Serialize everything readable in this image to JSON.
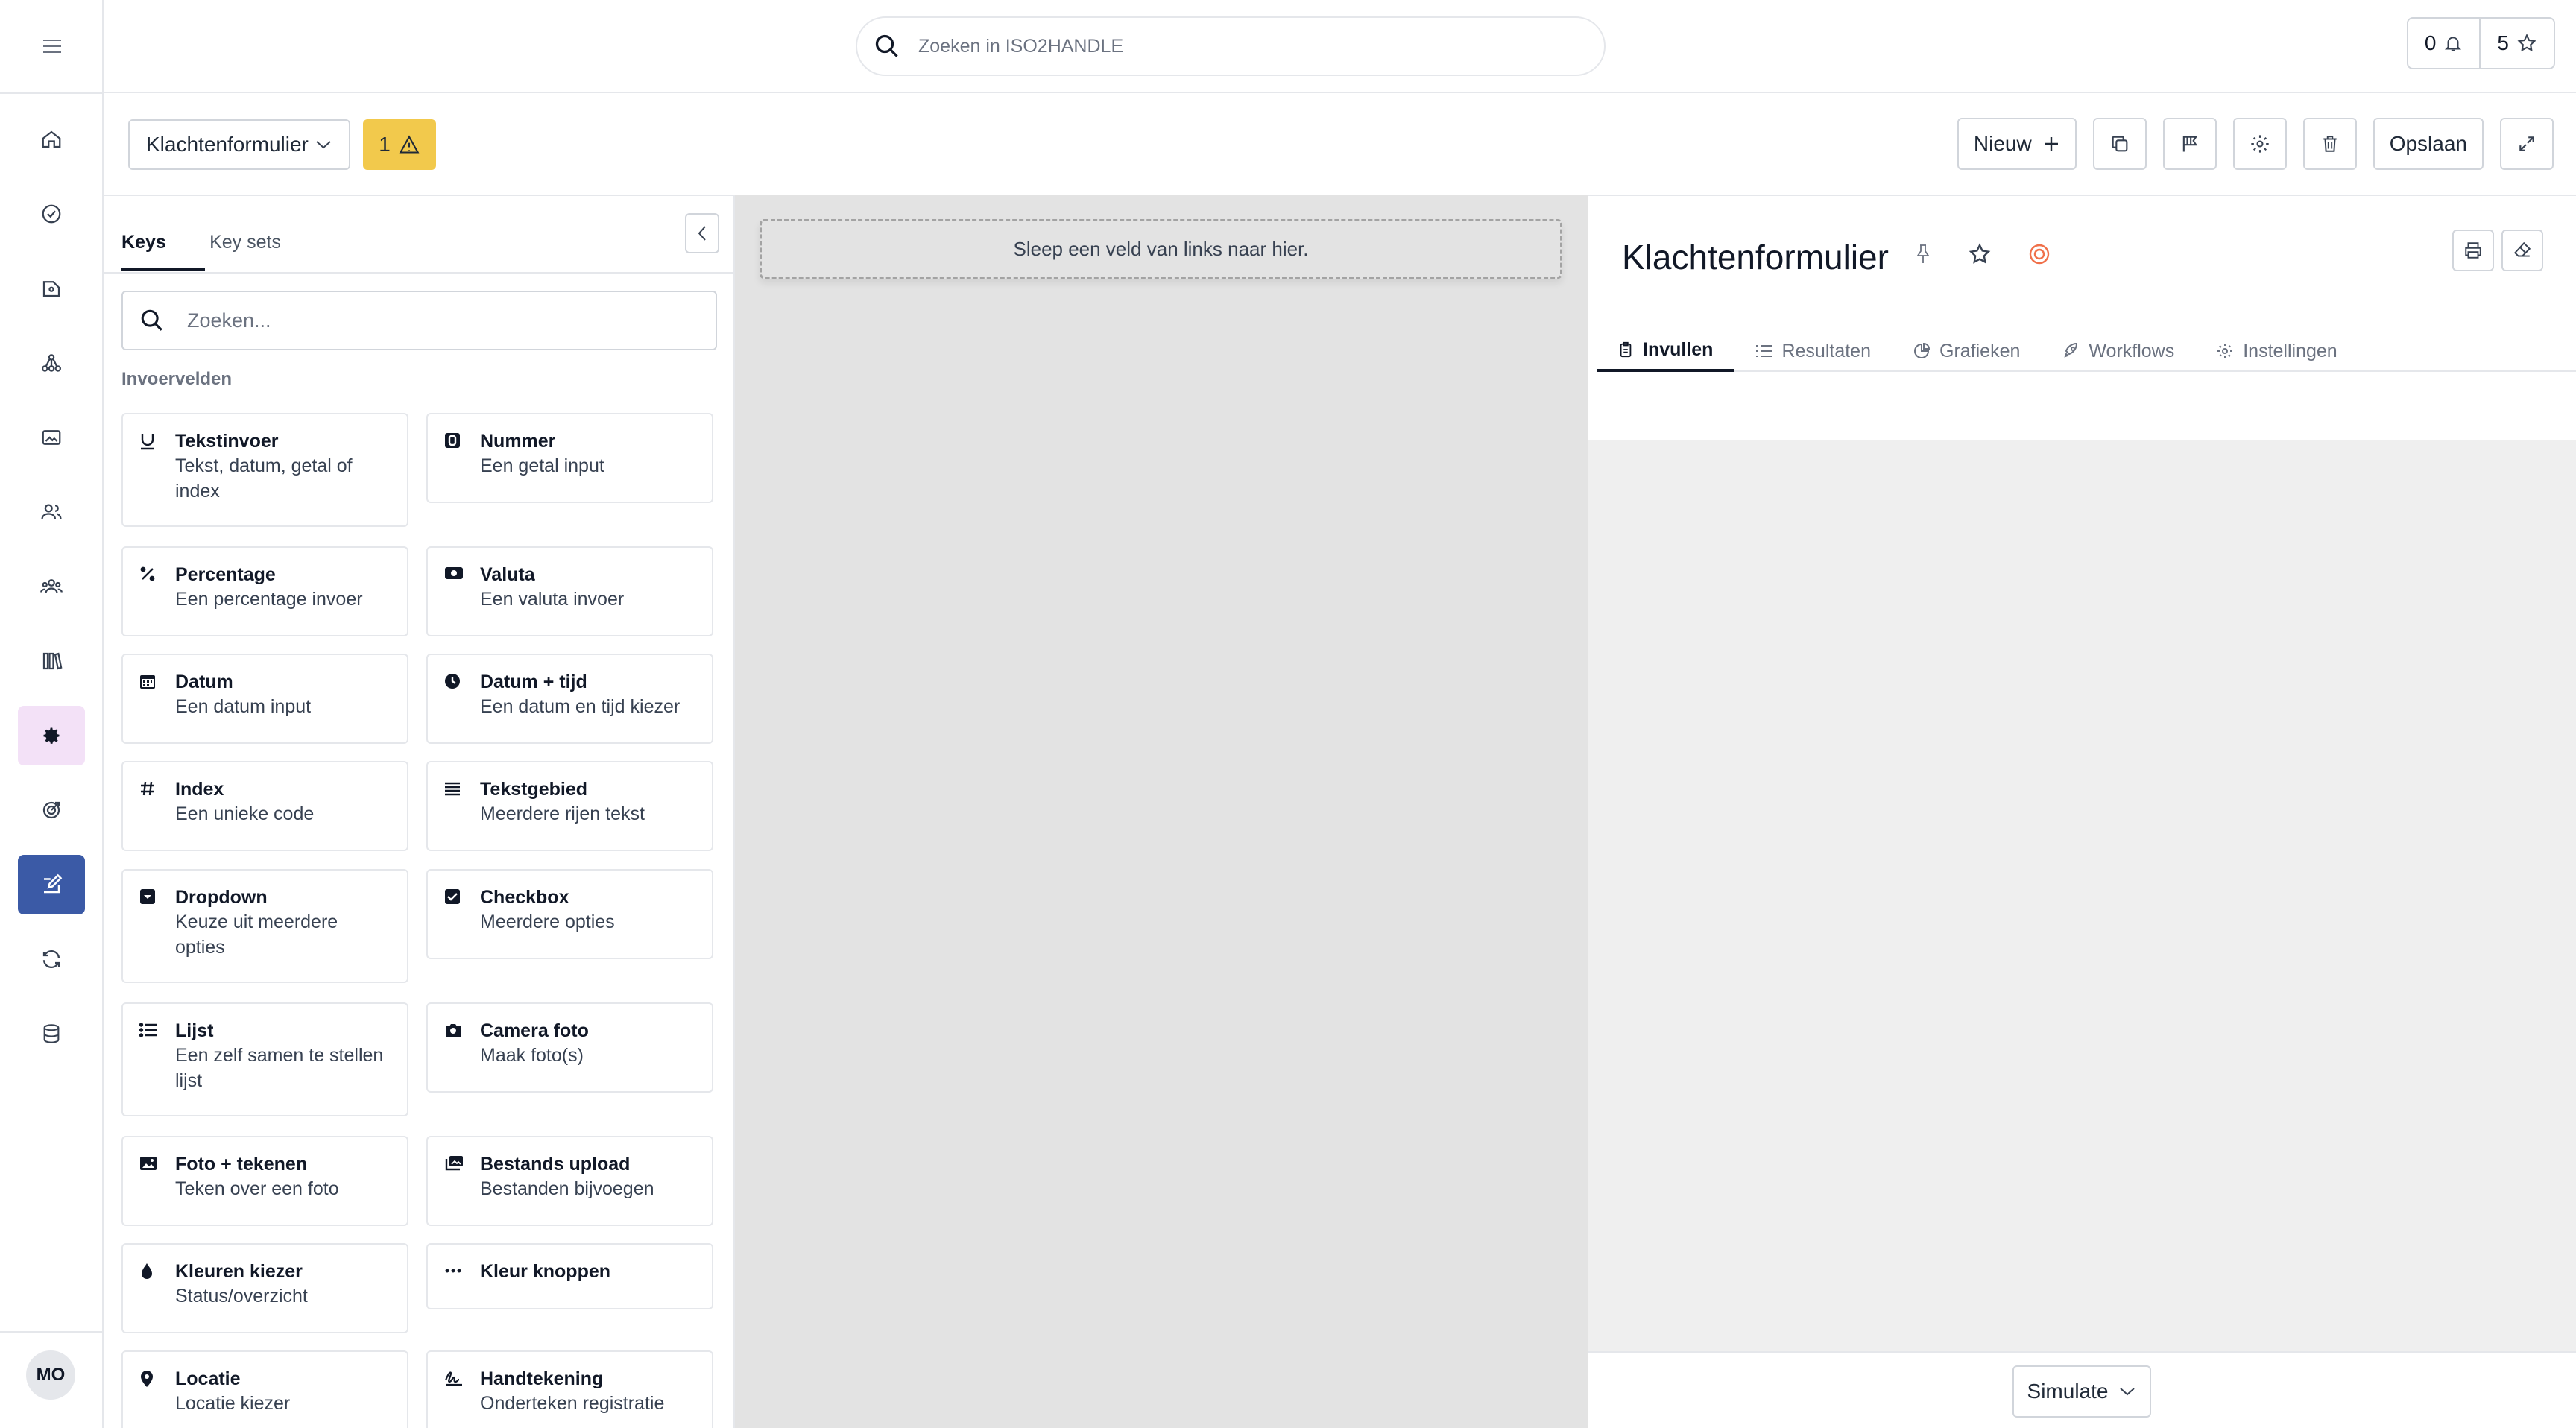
{
  "topbar": {
    "search_placeholder": "Zoeken in ISO2HANDLE",
    "notifications_count": "0",
    "favorites_count": "5"
  },
  "sidebar": {
    "items": [
      "home-icon",
      "check-circle-icon",
      "folder-icon",
      "network-icon",
      "image-folder-icon",
      "users-icon",
      "team-icon",
      "library-icon",
      "settings-icon",
      "target-icon",
      "form-edit-icon",
      "sync-icon",
      "database-icon"
    ],
    "avatar_initials": "MO"
  },
  "toolbar": {
    "form_select": "Klachtenformulier",
    "warning_count": "1",
    "new_label": "Nieuw",
    "save_label": "Opslaan"
  },
  "left_panel": {
    "tabs": [
      "Keys",
      "Key sets"
    ],
    "search_placeholder": "Zoeken...",
    "section_title": "Invoervelden",
    "fields": [
      {
        "title": "Tekstinvoer",
        "desc": "Tekst, datum, getal of index",
        "icon": "text-input-icon"
      },
      {
        "title": "Nummer",
        "desc": "Een getal input",
        "icon": "number-icon"
      },
      {
        "title": "Percentage",
        "desc": "Een percentage invoer",
        "icon": "percentage-icon"
      },
      {
        "title": "Valuta",
        "desc": "Een valuta invoer",
        "icon": "currency-icon"
      },
      {
        "title": "Datum",
        "desc": "Een datum input",
        "icon": "calendar-icon"
      },
      {
        "title": "Datum + tijd",
        "desc": "Een datum en tijd kiezer",
        "icon": "clock-icon"
      },
      {
        "title": "Index",
        "desc": "Een unieke code",
        "icon": "hash-icon"
      },
      {
        "title": "Tekstgebied",
        "desc": "Meerdere rijen tekst",
        "icon": "textarea-icon"
      },
      {
        "title": "Dropdown",
        "desc": "Keuze uit meerdere opties",
        "icon": "dropdown-icon"
      },
      {
        "title": "Checkbox",
        "desc": "Meerdere opties",
        "icon": "checkbox-icon"
      },
      {
        "title": "Lijst",
        "desc": "Een zelf samen te stellen lijst",
        "icon": "list-icon"
      },
      {
        "title": "Camera foto",
        "desc": "Maak foto(s)",
        "icon": "camera-icon"
      },
      {
        "title": "Foto + tekenen",
        "desc": "Teken over een foto",
        "icon": "photo-icon"
      },
      {
        "title": "Bestands upload",
        "desc": "Bestanden bijvoegen",
        "icon": "files-icon"
      },
      {
        "title": "Kleuren kiezer",
        "desc": "Status/overzicht",
        "icon": "droplet-icon"
      },
      {
        "title": "Kleur knoppen",
        "desc": "",
        "icon": "dots-icon"
      },
      {
        "title": "Locatie",
        "desc": "Locatie kiezer",
        "icon": "pin-icon"
      },
      {
        "title": "Handtekening",
        "desc": "Onderteken registratie",
        "icon": "signature-icon"
      }
    ]
  },
  "canvas": {
    "dropzone_text": "Sleep een veld van links naar hier."
  },
  "right_panel": {
    "title": "Klachtenformulier",
    "tabs": [
      "Invullen",
      "Resultaten",
      "Grafieken",
      "Workflows",
      "Instellingen"
    ],
    "simulate_label": "Simulate"
  },
  "colors": {
    "warning": "#f2c94c",
    "active_nav": "#3b5aa6",
    "settings_nav": "#f3e1f7",
    "canvas_bg": "#e3e3e3",
    "status_orange": "#f0704a"
  }
}
